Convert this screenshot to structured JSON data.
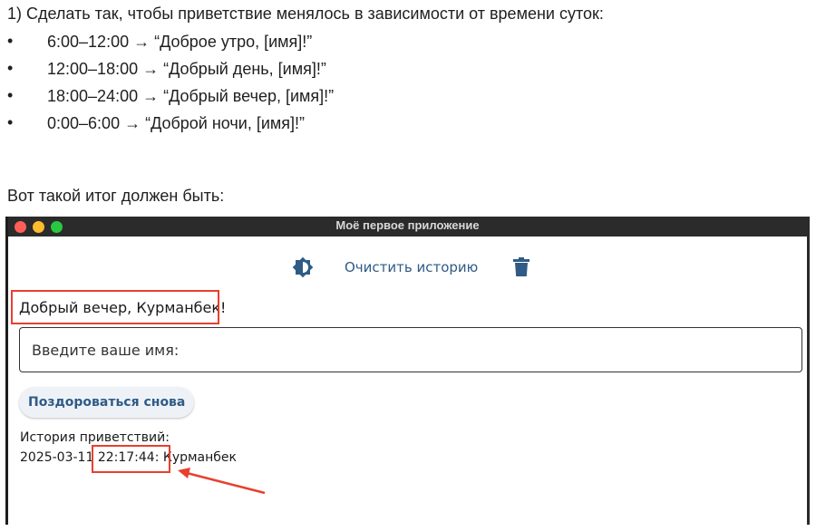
{
  "doc": {
    "task_line": "1) Сделать так, чтобы приветствие менялось в зависимости от времени суток:",
    "bullet_symbol": "•",
    "bullets": [
      "6:00–12:00 → “Доброе утро, [имя]!”",
      "12:00–18:00 → “Добрый день, [имя]!”",
      "18:00–24:00 → “Добрый вечер, [имя]!”",
      "0:00–6:00 → “Доброй ночи, [имя]!”"
    ],
    "result_line": "Вот такой итог должен быть:"
  },
  "window": {
    "title": "Моё первое приложение",
    "traffic_colors": [
      "#ff5f57",
      "#febc2e",
      "#28c840"
    ]
  },
  "toolbar": {
    "theme_icon": "brightness-icon",
    "clear_history_label": "Очистить историю",
    "delete_icon": "trash-icon"
  },
  "app": {
    "greeting": "Добрый вечер, Курманбек!",
    "name_placeholder": "Введите ваше имя:",
    "greet_again_label": "Поздороваться снова",
    "history_label": "История приветствий:",
    "history_entries": [
      {
        "date": "2025-03-11",
        "time": "22:17:44:",
        "name": "Курманбек"
      }
    ]
  },
  "colors": {
    "accent": "#2f5b86",
    "annotation": "#e8402e",
    "titlebar": "#2b2b2b"
  }
}
